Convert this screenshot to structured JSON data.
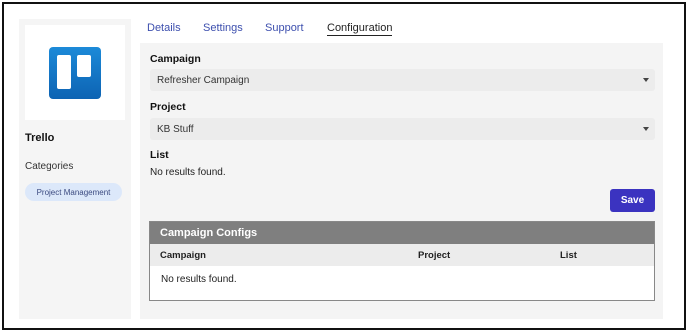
{
  "app": {
    "name": "Trello",
    "categories_label": "Categories",
    "category_chip": "Project Management",
    "colors": {
      "logo": "#0d63b3",
      "chip": "#dce8fa"
    }
  },
  "tabs": [
    {
      "label": "Details",
      "active": false
    },
    {
      "label": "Settings",
      "active": false
    },
    {
      "label": "Support",
      "active": false
    },
    {
      "label": "Configuration",
      "active": true
    }
  ],
  "form": {
    "campaign": {
      "label": "Campaign",
      "value": "Refresher Campaign"
    },
    "project": {
      "label": "Project",
      "value": "KB Stuff"
    },
    "list": {
      "label": "List",
      "empty_text": "No results found."
    },
    "save_label": "Save",
    "colors": {
      "save": "#3b33c0"
    }
  },
  "campaign_configs": {
    "title": "Campaign Configs",
    "columns": [
      "Campaign",
      "Project",
      "List"
    ],
    "empty_text": "No results found."
  }
}
